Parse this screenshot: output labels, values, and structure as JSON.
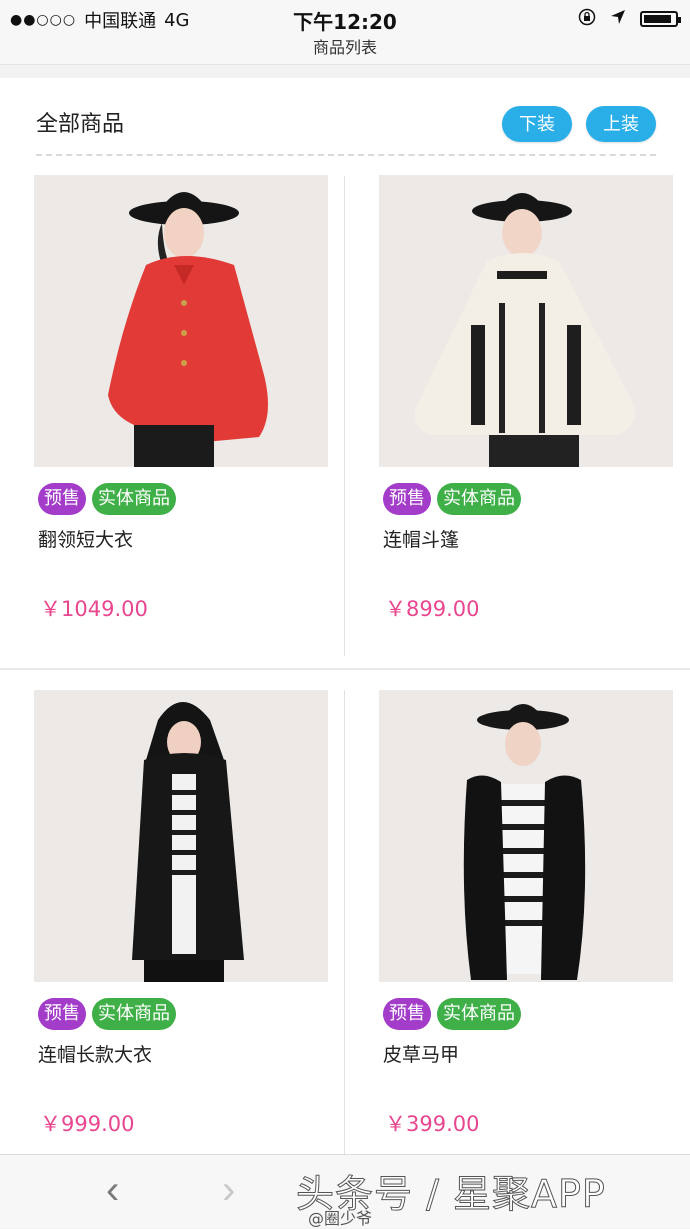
{
  "status_bar": {
    "signal": "●●○○○",
    "carrier": "中国联通",
    "network": "4G",
    "time": "下午12:20",
    "icons": [
      "orientation-lock-icon",
      "location-icon",
      "battery-icon"
    ]
  },
  "nav": {
    "title": "商品列表"
  },
  "header": {
    "title": "全部商品",
    "down_label": "下装",
    "up_label": "上装"
  },
  "products": [
    {
      "tag_presale": "预售",
      "tag_physical": "实体商品",
      "name": "翻领短大衣",
      "price": "￥1049.00"
    },
    {
      "tag_presale": "预售",
      "tag_physical": "实体商品",
      "name": "连帽斗篷",
      "price": "￥899.00"
    },
    {
      "tag_presale": "预售",
      "tag_physical": "实体商品",
      "name": "连帽长款大衣",
      "price": "￥999.00"
    },
    {
      "tag_presale": "预售",
      "tag_physical": "实体商品",
      "name": "皮草马甲",
      "price": "￥399.00"
    }
  ],
  "bottom": {
    "back_glyph": "‹",
    "forward_glyph": "›",
    "watermark": "头条号 / 星聚APP",
    "watermark_sub": "@圈少爷"
  },
  "colors": {
    "accent_blue": "#29aee8",
    "tag_presale": "#a23cc9",
    "tag_physical": "#3fb048",
    "price": "#e8468f"
  }
}
